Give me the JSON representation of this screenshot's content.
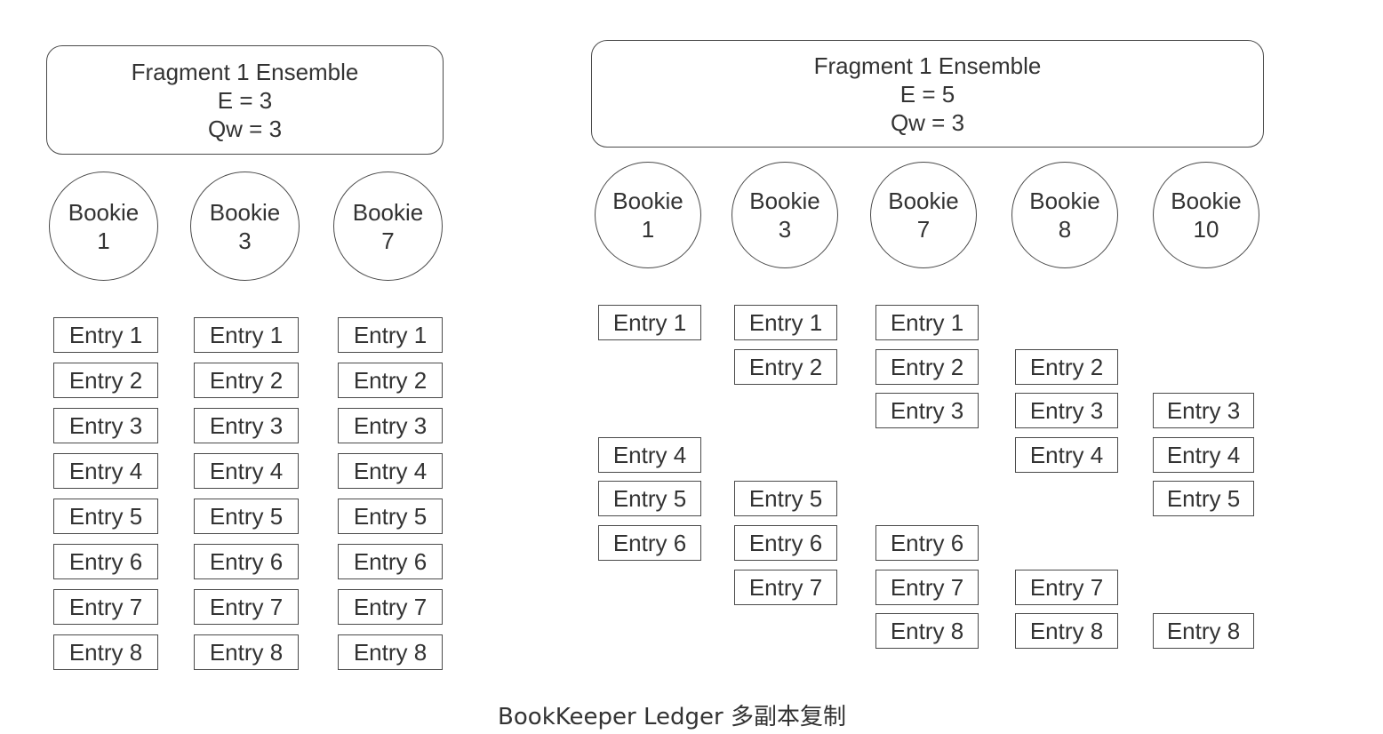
{
  "left": {
    "ensemble": {
      "line1": "Fragment 1 Ensemble",
      "line2": "E = 3",
      "line3": "Qw = 3"
    },
    "bookies": [
      {
        "name": "Bookie",
        "id": "1"
      },
      {
        "name": "Bookie",
        "id": "3"
      },
      {
        "name": "Bookie",
        "id": "7"
      }
    ],
    "entries": [
      [
        "Entry 1",
        "Entry 2",
        "Entry 3",
        "Entry 4",
        "Entry 5",
        "Entry 6",
        "Entry 7",
        "Entry 8"
      ],
      [
        "Entry 1",
        "Entry 2",
        "Entry 3",
        "Entry 4",
        "Entry 5",
        "Entry 6",
        "Entry 7",
        "Entry 8"
      ],
      [
        "Entry 1",
        "Entry 2",
        "Entry 3",
        "Entry 4",
        "Entry 5",
        "Entry 6",
        "Entry 7",
        "Entry 8"
      ]
    ]
  },
  "right": {
    "ensemble": {
      "line1": "Fragment 1 Ensemble",
      "line2": "E = 5",
      "line3": "Qw = 3"
    },
    "bookies": [
      {
        "name": "Bookie",
        "id": "1"
      },
      {
        "name": "Bookie",
        "id": "3"
      },
      {
        "name": "Bookie",
        "id": "7"
      },
      {
        "name": "Bookie",
        "id": "8"
      },
      {
        "name": "Bookie",
        "id": "10"
      }
    ],
    "entries": [
      [
        "Entry 1",
        "",
        "",
        "Entry 4",
        "Entry 5",
        "Entry 6",
        "",
        ""
      ],
      [
        "Entry 1",
        "Entry 2",
        "",
        "",
        "Entry 5",
        "Entry 6",
        "Entry 7",
        ""
      ],
      [
        "Entry 1",
        "Entry 2",
        "Entry 3",
        "",
        "",
        "Entry 6",
        "Entry 7",
        "Entry 8"
      ],
      [
        "",
        "Entry 2",
        "Entry 3",
        "Entry 4",
        "",
        "",
        "Entry 7",
        "Entry 8"
      ],
      [
        "",
        "",
        "Entry 3",
        "Entry 4",
        "Entry 5",
        "",
        "",
        "Entry 8"
      ]
    ]
  },
  "caption": "BookKeeper Ledger 多副本复制"
}
